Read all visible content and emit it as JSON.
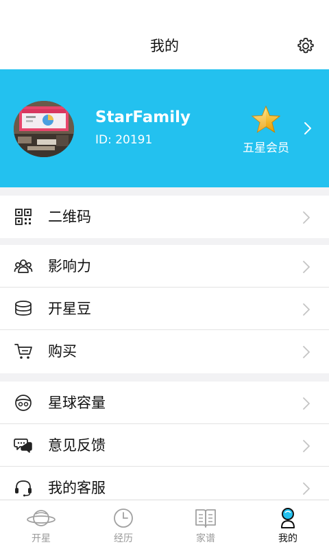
{
  "header": {
    "title": "我的"
  },
  "profile": {
    "username": "StarFamily",
    "user_id": "ID: 20191",
    "member_label": "五星会员"
  },
  "menu_groups": [
    [
      {
        "label": "二维码",
        "icon": "qr-code-icon"
      }
    ],
    [
      {
        "label": "影响力",
        "icon": "people-icon"
      },
      {
        "label": "开星豆",
        "icon": "coin-stack-icon"
      },
      {
        "label": "购买",
        "icon": "cart-icon"
      }
    ],
    [
      {
        "label": "星球容量",
        "icon": "planet-capacity-icon"
      },
      {
        "label": "意见反馈",
        "icon": "chat-bubbles-icon"
      },
      {
        "label": "我的客服",
        "icon": "headset-icon"
      }
    ]
  ],
  "tabbar": {
    "tabs": [
      {
        "label": "开星",
        "icon": "planet-icon",
        "active": false
      },
      {
        "label": "经历",
        "icon": "clock-icon",
        "active": false
      },
      {
        "label": "家谱",
        "icon": "book-icon",
        "active": false
      },
      {
        "label": "我的",
        "icon": "person-icon",
        "active": true
      }
    ]
  },
  "colors": {
    "accent": "#23c1ef",
    "separator": "#f2f2f4",
    "star_gold": "#f5b800",
    "tab_inactive": "#9a9a9a"
  }
}
